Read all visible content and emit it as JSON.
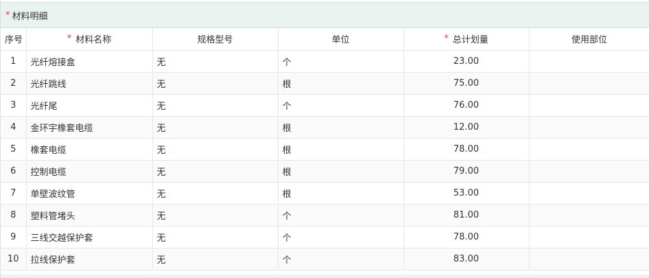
{
  "section": {
    "required_mark": "*",
    "title": "材料明细"
  },
  "table": {
    "columns": [
      {
        "key": "index",
        "label": "序号",
        "required": false
      },
      {
        "key": "name",
        "label": "材料名称",
        "required": true
      },
      {
        "key": "spec",
        "label": "规格型号",
        "required": false
      },
      {
        "key": "unit",
        "label": "单位",
        "required": false
      },
      {
        "key": "total_plan",
        "label": "总计划量",
        "required": true
      },
      {
        "key": "usage_dept",
        "label": "使用部位",
        "required": false
      }
    ],
    "required_mark": "*",
    "rows": [
      {
        "index": "1",
        "name": "光纤熔接盒",
        "spec": "无",
        "unit": "个",
        "total_plan": "23.00",
        "usage_dept": ""
      },
      {
        "index": "2",
        "name": "光纤跳线",
        "spec": "无",
        "unit": "根",
        "total_plan": "75.00",
        "usage_dept": ""
      },
      {
        "index": "3",
        "name": "光纤尾",
        "spec": "无",
        "unit": "个",
        "total_plan": "76.00",
        "usage_dept": ""
      },
      {
        "index": "4",
        "name": "金环宇橡套电缆",
        "spec": "无",
        "unit": "根",
        "total_plan": "12.00",
        "usage_dept": ""
      },
      {
        "index": "5",
        "name": "橡套电缆",
        "spec": "无",
        "unit": "根",
        "total_plan": "78.00",
        "usage_dept": ""
      },
      {
        "index": "6",
        "name": "控制电缆",
        "spec": "无",
        "unit": "根",
        "total_plan": "79.00",
        "usage_dept": ""
      },
      {
        "index": "7",
        "name": "单壁波纹管",
        "spec": "无",
        "unit": "根",
        "total_plan": "53.00",
        "usage_dept": ""
      },
      {
        "index": "8",
        "name": "塑料管堵头",
        "spec": "无",
        "unit": "个",
        "total_plan": "81.00",
        "usage_dept": ""
      },
      {
        "index": "9",
        "name": "三线交越保护套",
        "spec": "无",
        "unit": "个",
        "total_plan": "78.00",
        "usage_dept": ""
      },
      {
        "index": "10",
        "name": "拉线保护套",
        "spec": "无",
        "unit": "个",
        "total_plan": "83.00",
        "usage_dept": ""
      }
    ]
  },
  "colors": {
    "header_bg": "#e8f3f0",
    "required": "#e53935",
    "border": "#e4e7ed"
  }
}
